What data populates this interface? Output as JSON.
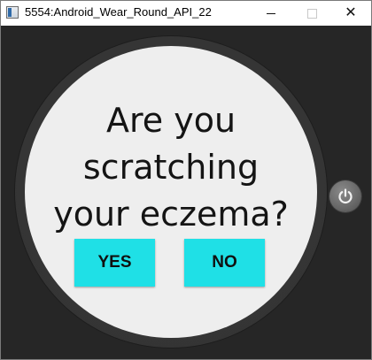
{
  "window": {
    "title": "5554:Android_Wear_Round_API_22"
  },
  "icons": {
    "app": "emulator-app-icon",
    "minimize": "minimize-icon",
    "maximize": "maximize-icon",
    "close": "close-icon",
    "power": "power-icon"
  },
  "watch": {
    "question_lines": [
      "Are you",
      "scratching",
      "your eczema?"
    ],
    "yes_label": "YES",
    "no_label": "NO"
  },
  "colors": {
    "background": "#262626",
    "bezel": "#353535",
    "screen": "#eeeeee",
    "button": "#1fe0e6",
    "text": "#141414"
  }
}
